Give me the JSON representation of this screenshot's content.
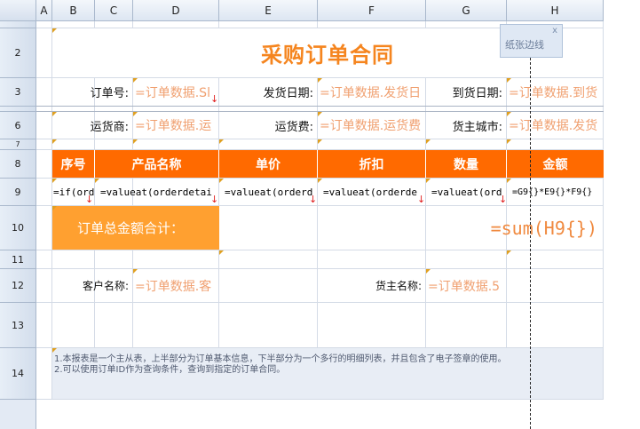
{
  "columns": [
    "A",
    "B",
    "C",
    "D",
    "E",
    "F",
    "G",
    "H"
  ],
  "rows": [
    "2",
    "3",
    "6",
    "7",
    "8",
    "9",
    "10",
    "11",
    "12",
    "13",
    "14"
  ],
  "title": "采购订单合同",
  "labels": {
    "order_no": "订单号:",
    "ship_date": "发货日期:",
    "arrive_date": "到货日期:",
    "carrier": "运货商:",
    "freight": "运货费:",
    "city": "货主城市:",
    "customer": "客户名称:",
    "owner": "货主名称:"
  },
  "fields": {
    "order_no": "=订单数据.Sl",
    "ship_date": "=订单数据.发货日",
    "arrive_date": "=订单数据.到货",
    "carrier": "=订单数据.运",
    "freight": "=订单数据.运货费",
    "city": "=订单数据.发货",
    "customer": "=订单数据.客",
    "owner": "=订单数据.5"
  },
  "table_headers": [
    "序号",
    "产品名称",
    "单价",
    "折扣",
    "数量",
    "金额"
  ],
  "formulas": [
    "=if(ord",
    "=valueat(orderdetai",
    "=valueat(orderd",
    "=valueat(orderde",
    "=valueat(ord",
    "=G9{}*E9{}*F9{}"
  ],
  "total_label": "订单总金额合计：",
  "total_formula": "=sum(H9{})",
  "notes": [
    "1.本报表是一个主从表，上半部分为订单基本信息，下半部分为一个多行的明细列表，并且包含了电子签章的使用。",
    "2.可以使用订单ID作为查询条件，查询到指定的订单合同。"
  ],
  "tooltip": {
    "text": "纸张边线",
    "close": "x"
  },
  "colors": {
    "header_orange": "#ff6a00",
    "total_orange": "#ffa030",
    "field_text": "#f0a070",
    "title_orange": "#f5851f"
  }
}
